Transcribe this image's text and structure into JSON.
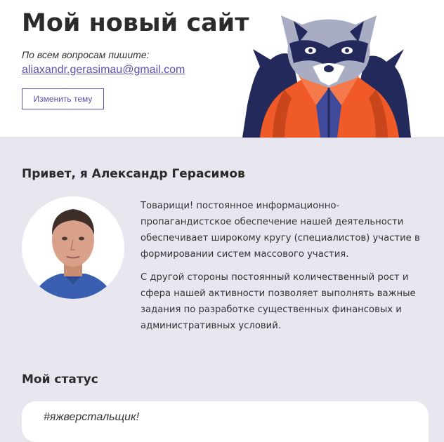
{
  "header": {
    "title": "Мой новый сайт",
    "contact_text": "По всем вопросам пишите:",
    "email": "aliaxandr.gerasimau@gmail.com",
    "theme_button_label": "Изменить тему"
  },
  "about": {
    "heading": "Привет, я Александр Герасимов",
    "paragraphs": [
      "Товарищи! постоянное информационно-пропагандистское обеспечение нашей деятельности обеспечивает широкому кругу (специалистов) участие в формировании систем массового участия.",
      "С другой стороны постоянный количественный рост и сфера нашей активности позволяет выполнять важные задания по разработке существенных финансовых и административных условий."
    ]
  },
  "status": {
    "heading": "Мой статус",
    "text": "#яжверстальщик!"
  },
  "colors": {
    "background": "#e8e6ef",
    "accent": "#5b4fa8",
    "jacket_orange": "#f05a28",
    "mascot_navy": "#232a5b"
  },
  "icons": {
    "mascot": "raccoon-mascot-icon",
    "avatar": "person-avatar"
  }
}
